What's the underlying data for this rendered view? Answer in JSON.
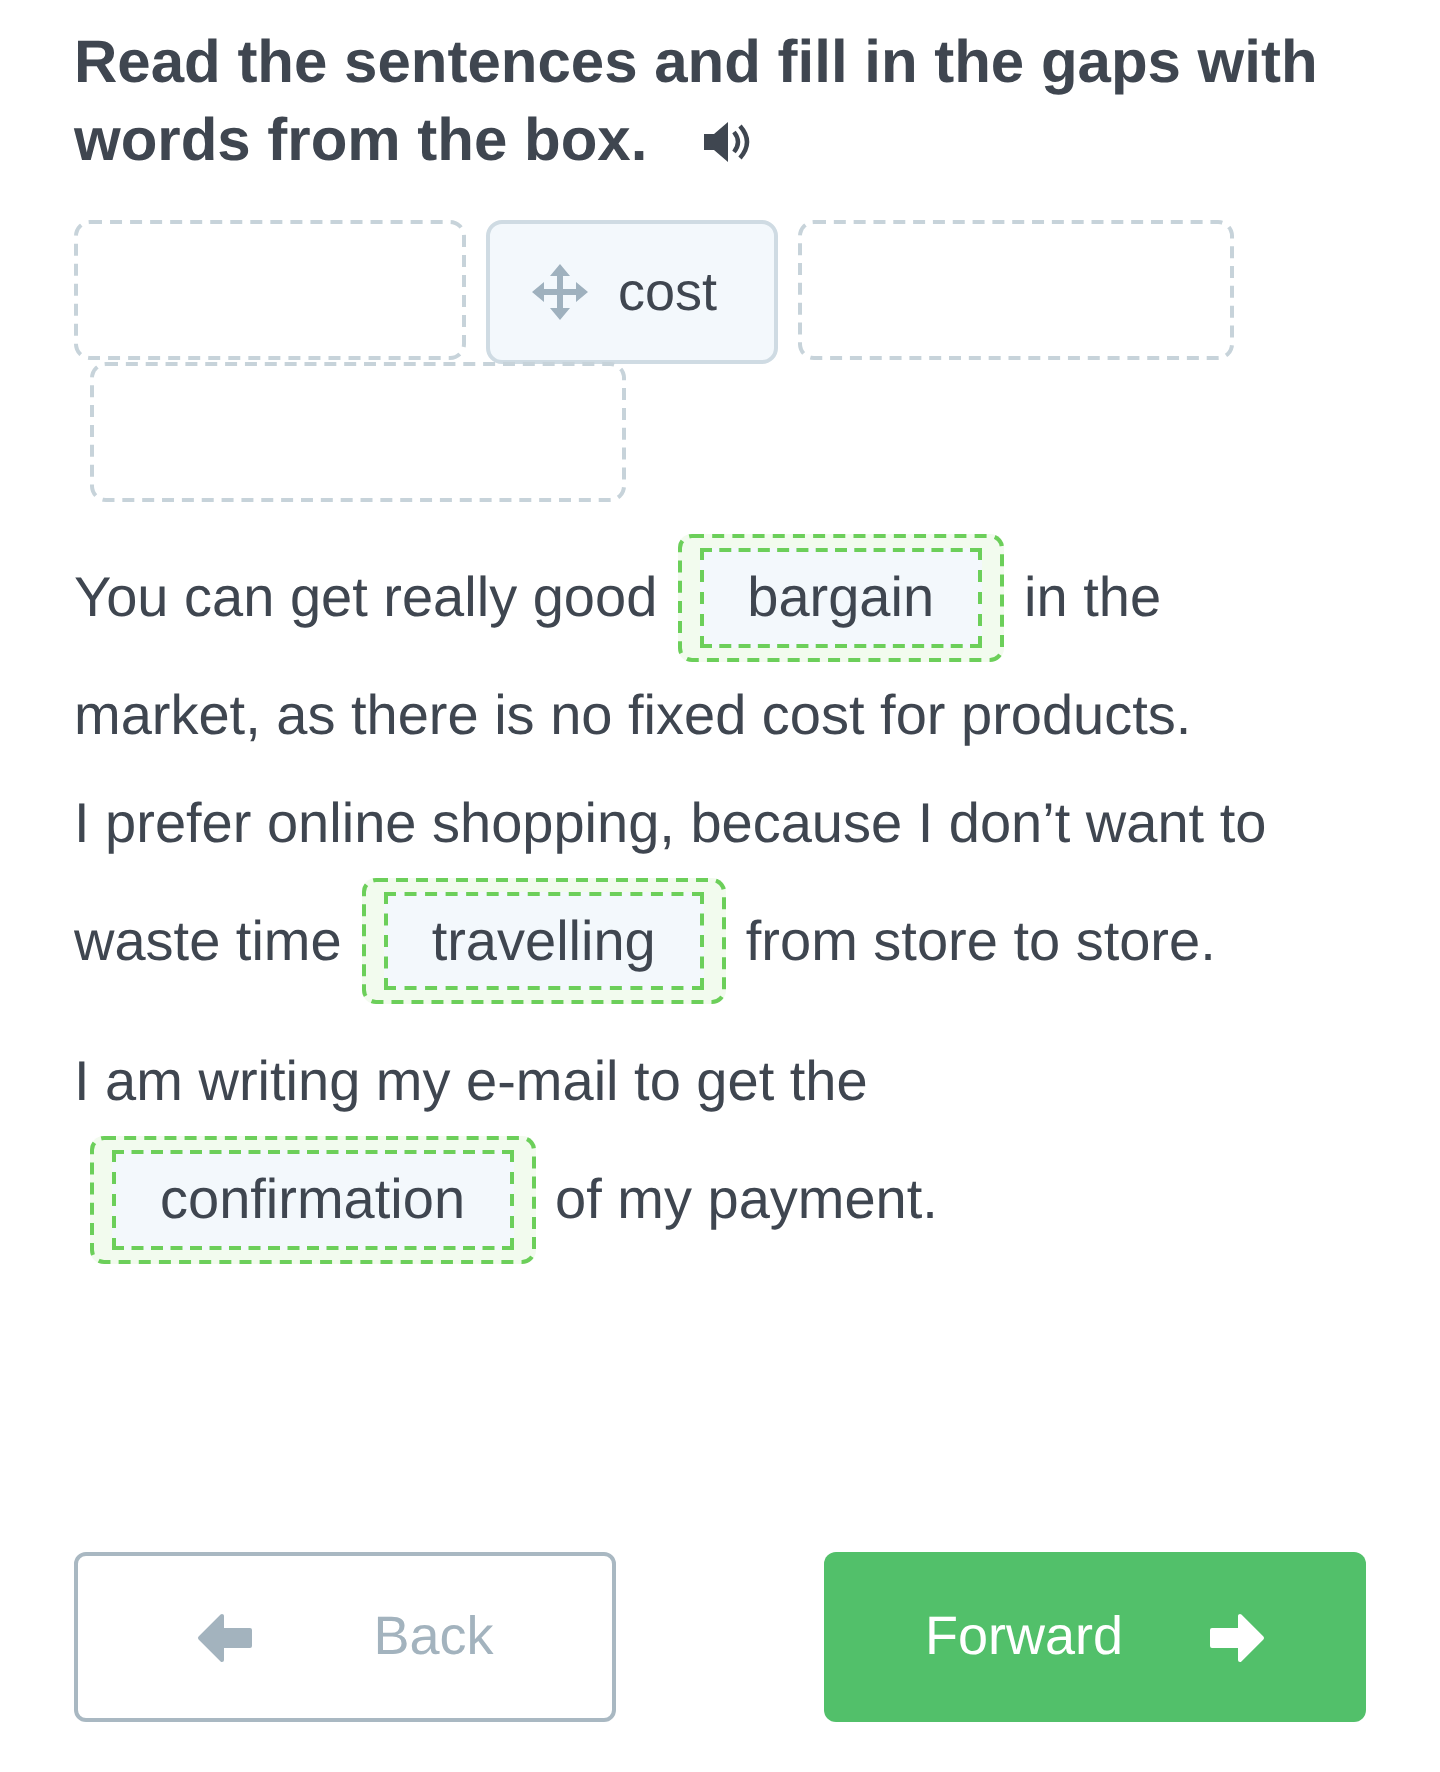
{
  "instruction": "Read the sentences and fill in the gaps with words from the box.",
  "word_bank": [
    {
      "kind": "empty"
    },
    {
      "kind": "word",
      "text": "cost"
    },
    {
      "kind": "empty"
    },
    {
      "kind": "empty"
    }
  ],
  "sentences": [
    {
      "lines": [
        [
          {
            "kind": "text",
            "text": "You can get really good"
          },
          {
            "kind": "gap",
            "text": "bargain",
            "correct": true
          },
          {
            "kind": "text",
            "text": "in the"
          }
        ],
        [
          {
            "kind": "text",
            "text": "market, as there is no fixed cost for products."
          }
        ]
      ]
    },
    {
      "lines": [
        [
          {
            "kind": "text",
            "text": "I prefer online shopping, because I don’t want to"
          }
        ],
        [
          {
            "kind": "text",
            "text": "waste time"
          },
          {
            "kind": "gap",
            "text": "travelling",
            "correct": true
          },
          {
            "kind": "text",
            "text": "from store to store."
          }
        ]
      ]
    },
    {
      "lines": [
        [
          {
            "kind": "text",
            "text": "I am writing my e-mail to get the"
          }
        ],
        [
          {
            "kind": "gap",
            "text": "confirmation",
            "correct": true
          },
          {
            "kind": "text",
            "text": "of my payment."
          }
        ]
      ]
    }
  ],
  "buttons": [
    {
      "kind": "back",
      "label": "Back"
    },
    {
      "kind": "forward",
      "label": "Forward"
    }
  ]
}
